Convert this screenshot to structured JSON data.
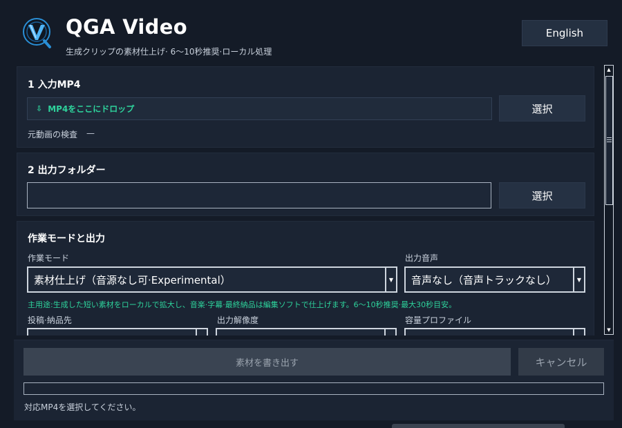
{
  "header": {
    "title": "QGA Video",
    "subtitle": "生成クリップの素材仕上げ· 6〜10秒推奨·ローカル処理",
    "logo_icon": "qga-v-logo-icon",
    "language_button": "English"
  },
  "section_input": {
    "title": "1 入力MP4",
    "dropzone_icon": "download-arrow-icon",
    "dropzone_text": "MP4をここにドロップ",
    "select_button": "選択",
    "inspect_label": "元動画の検査",
    "inspect_value": "—"
  },
  "section_output_folder": {
    "title": "2 出力フォルダー",
    "folder_value": "",
    "select_button": "選択"
  },
  "section_mode": {
    "title": "作業モードと出力",
    "work_mode_label": "作業モード",
    "work_mode_value": "素材仕上げ（音源なし可·Experimental）",
    "audio_label": "出力音声",
    "audio_value": "音声なし（音声トラックなし）",
    "hint": "主用途:生成した短い素材をローカルで拡大し、音楽·字幕·最終納品は編集ソフトで仕上げます。6〜10秒推奨·最大30秒目安。",
    "destination_label": "投稿·納品先",
    "resolution_label": "出力解像度",
    "size_profile_label": "容量プロファイル"
  },
  "footer": {
    "export_button": "素材を書き出す",
    "cancel_button": "キャンセル",
    "progress": 0,
    "status": "対応MP4を選択してください。"
  },
  "colors": {
    "background": "#141b27",
    "card": "#1b2433",
    "accent": "#2ed39c",
    "button": "#253143"
  }
}
